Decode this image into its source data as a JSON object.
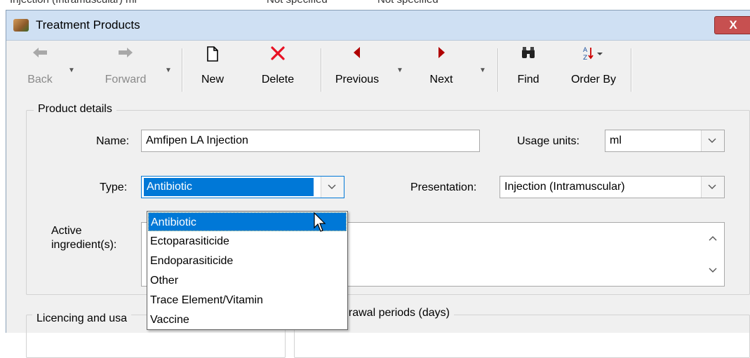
{
  "background": {
    "partial_text_1": "Injection (Intramuscular)  ml",
    "partial_text_2": "Not specified",
    "partial_text_3": "Not specified"
  },
  "window": {
    "title": "Treatment Products",
    "close_label": "X"
  },
  "toolbar": {
    "back": "Back",
    "forward": "Forward",
    "new": "New",
    "delete": "Delete",
    "previous": "Previous",
    "next": "Next",
    "find": "Find",
    "order_by": "Order By"
  },
  "product_details": {
    "group_label": "Product details",
    "name_label": "Name:",
    "name_value": "Amfipen LA Injection",
    "usage_units_label": "Usage units:",
    "usage_units_value": "ml",
    "type_label": "Type:",
    "type_value": "Antibiotic",
    "presentation_label": "Presentation:",
    "presentation_value": "Injection (Intramuscular)",
    "active_label_1": "Active",
    "active_label_2": "ingredient(s):",
    "active_value": ""
  },
  "type_dropdown": {
    "options": [
      "Antibiotic",
      "Ectoparasiticide",
      "Endoparasiticide",
      "Other",
      "Trace Element/Vitamin",
      "Vaccine"
    ],
    "selected": "Antibiotic"
  },
  "licencing": {
    "group_label": "Licencing and usa"
  },
  "withdrawal": {
    "group_label": "drawal periods (days)"
  },
  "colors": {
    "titlebar": "#cfe0f3",
    "selection": "#0078d7",
    "close": "#c75050",
    "delete_icon": "#e81123",
    "nav_arrow": "#b00000"
  }
}
